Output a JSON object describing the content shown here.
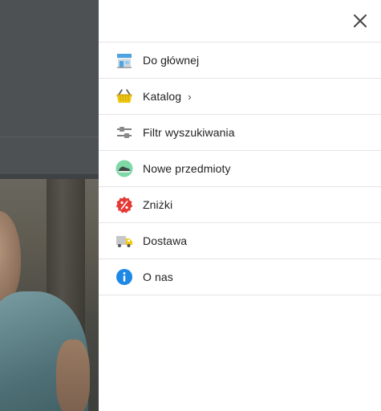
{
  "drawer": {
    "close_icon": "close-icon",
    "items": [
      {
        "label": "Do głównej",
        "icon": "store-icon"
      },
      {
        "label": "Katalog",
        "icon": "basket-icon",
        "has_submenu": true,
        "chevron": "›"
      },
      {
        "label": "Filtr wyszukiwania",
        "icon": "sliders-icon"
      },
      {
        "label": "Nowe przedmioty",
        "icon": "sneaker-icon"
      },
      {
        "label": "Zniżki",
        "icon": "discount-badge-icon"
      },
      {
        "label": "Dostawa",
        "icon": "delivery-truck-icon"
      },
      {
        "label": "O nas",
        "icon": "info-icon"
      }
    ]
  },
  "colors": {
    "overlay": "#4b4f52",
    "drawer_background": "#ffffff",
    "divider": "#e4e4e4",
    "text": "#222222",
    "info_blue": "#1e88e5",
    "discount_red": "#e53935",
    "new_items_green": "#7ed9a6",
    "basket_yellow": "#f2c811"
  }
}
